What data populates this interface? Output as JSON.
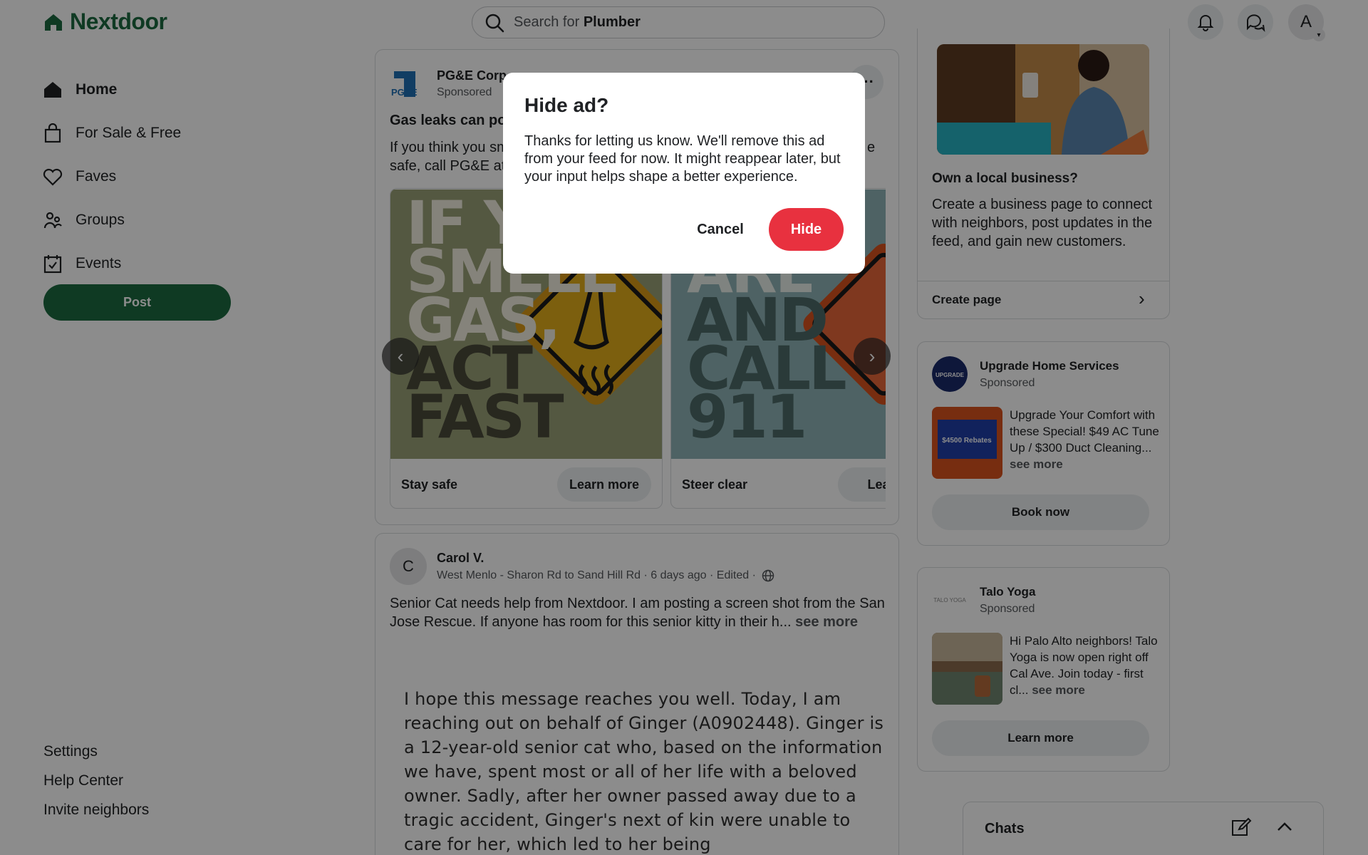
{
  "header": {
    "brand": "Nextdoor",
    "search_prefix": "Search for",
    "search_term": "Plumber",
    "avatar_initial": "A"
  },
  "nav": {
    "items": [
      {
        "label": "Home",
        "icon": "home-icon"
      },
      {
        "label": "For Sale & Free",
        "icon": "bag-icon"
      },
      {
        "label": "Faves",
        "icon": "heart-icon"
      },
      {
        "label": "Groups",
        "icon": "groups-icon"
      },
      {
        "label": "Events",
        "icon": "calendar-icon"
      }
    ],
    "post_label": "Post",
    "footer_links": [
      "Settings",
      "Help Center",
      "Invite neighbors"
    ]
  },
  "ad_post": {
    "advertiser": "PG&E Corp.",
    "sponsored": "Sponsored",
    "logo_text": "PG&E",
    "headline": "Gas leaks can pos",
    "body_line1": "If you think you sm",
    "body_line1_end": "e",
    "body_line2": "safe, call PG&E at",
    "slides": [
      {
        "image_text": [
          "IF Y",
          "SMELL",
          "GAS,",
          "ACT",
          "FAST"
        ],
        "caption": "Stay safe",
        "button": "Learn more"
      },
      {
        "image_text": [
          "THE ARE",
          "AND",
          "CALL",
          "911"
        ],
        "caption": "Steer clear",
        "button": "Learn"
      }
    ]
  },
  "user_post": {
    "avatar_initial": "C",
    "author": "Carol V.",
    "meta": "West Menlo - Sharon Rd to Sand Hill Rd · 6 days ago · Edited ·",
    "body": "Senior Cat needs help from Nextdoor.  I am posting a screen shot from the San Jose Rescue.  If anyone has room for this senior kitty in their h...",
    "see_more": "see more",
    "screenshot_text": "I hope this message reaches you well. Today, I am reaching out on behalf of Ginger (A0902448). Ginger is a 12-year-old senior cat who, based on the information we have, spent most or all of her life with a beloved owner. Sadly, after her owner passed away due to a tragic accident, Ginger's next of kin were unable to care for her, which led to her being"
  },
  "right_rail": {
    "business": {
      "title": "Own a local business?",
      "text": "Create a business page to connect with neighbors, post updates in the feed, and gain new customers.",
      "link": "Create page"
    },
    "ads": [
      {
        "name": "Upgrade Home Services",
        "sponsored": "Sponsored",
        "logo_text": "UPGRADE",
        "thumb_text": "$4500 Rebates",
        "text": "Upgrade Your Comfort with these Special! $49 AC Tune Up / $300 Duct Cleaning...",
        "see_more": "see more",
        "button": "Book now"
      },
      {
        "name": "Talo Yoga",
        "sponsored": "Sponsored",
        "logo_text": "TALO YOGA",
        "text": "Hi Palo Alto neighbors! Talo Yoga is now open right off Cal Ave. Join today - first cl...",
        "see_more": "see more",
        "button": "Learn more"
      }
    ],
    "chats_label": "Chats"
  },
  "modal": {
    "title": "Hide ad?",
    "text": "Thanks for letting us know. We'll remove this ad from your feed for now. It might reappear later, but your input helps shape a better experience.",
    "cancel_label": "Cancel",
    "hide_label": "Hide"
  },
  "colors": {
    "brand_green": "#1d6b40",
    "hide_red": "#e8313f",
    "overlay": "rgba(0,0,0,0.45)"
  }
}
